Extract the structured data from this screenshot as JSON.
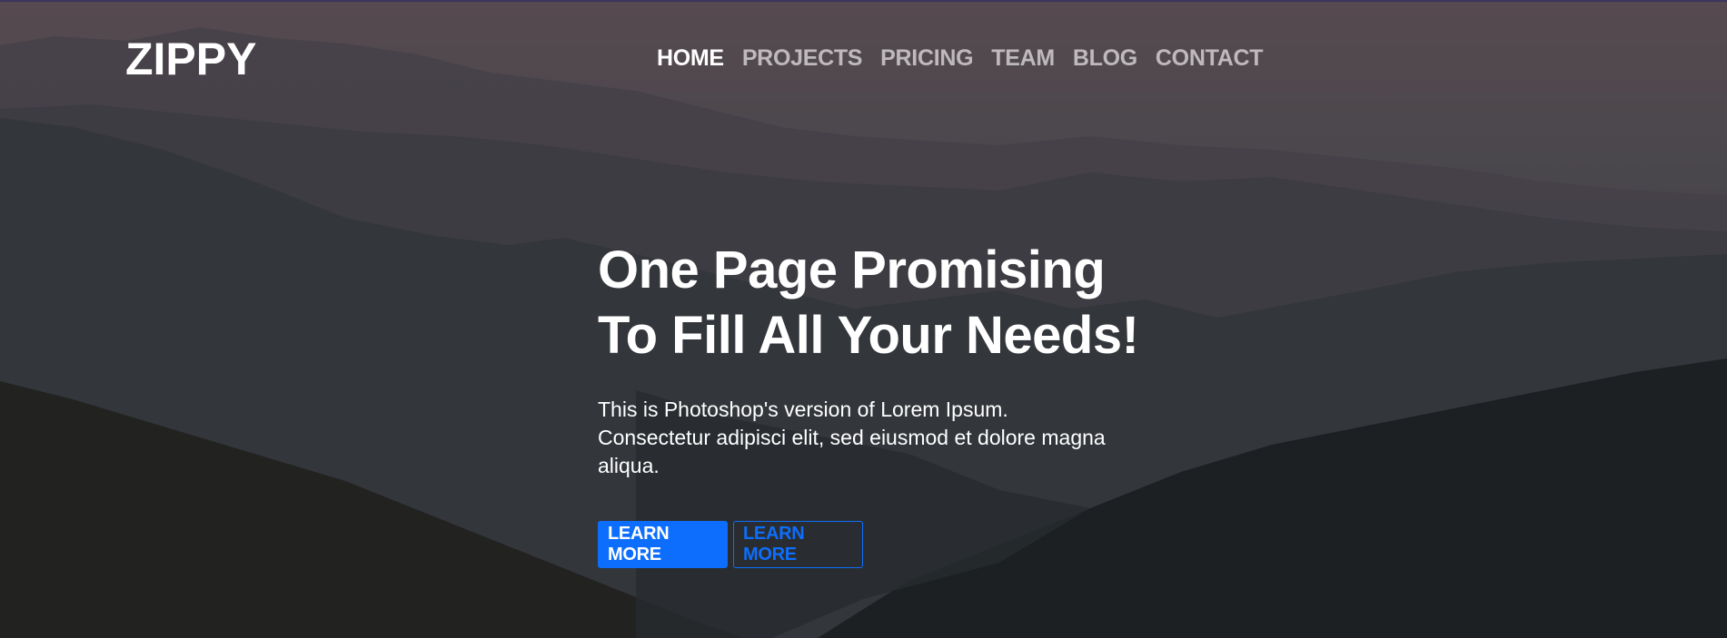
{
  "brand": {
    "name": "ZIPPY"
  },
  "nav": {
    "items": [
      {
        "label": "HOME",
        "active": true
      },
      {
        "label": "PROJECTS",
        "active": false
      },
      {
        "label": "PRICING",
        "active": false
      },
      {
        "label": "TEAM",
        "active": false
      },
      {
        "label": "BLOG",
        "active": false
      },
      {
        "label": "CONTACT",
        "active": false
      }
    ]
  },
  "hero": {
    "headline_line1": "One Page Promising",
    "headline_line2": "To Fill All Your Needs!",
    "description": "This is Photoshop's version of Lorem Ipsum. Consectetur adipisci elit, sed eiusmod et dolore magna aliqua.",
    "primary_button": "LEARN MORE",
    "secondary_button": "LEARN MORE"
  },
  "colors": {
    "accent": "#0d6efd",
    "text": "#ffffff"
  }
}
